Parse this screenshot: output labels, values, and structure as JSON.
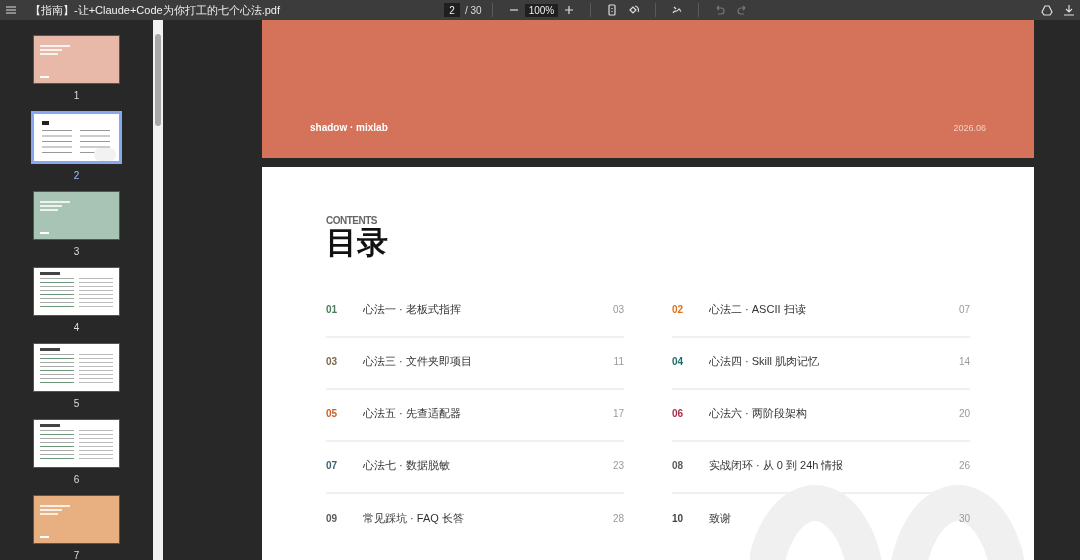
{
  "toolbar": {
    "title": "【指南】-让+Claude+Code为你打工的七个心法.pdf",
    "page_input": "2",
    "page_total": "/ 30",
    "zoom": "100%"
  },
  "thumbnails": [
    {
      "kind": "cover",
      "color": "#e8b8a8",
      "label": "1",
      "selected": false
    },
    {
      "kind": "contents",
      "label": "2",
      "selected": true
    },
    {
      "kind": "cover",
      "color": "#a8c4b4",
      "label": "3",
      "selected": false
    },
    {
      "kind": "text",
      "label": "4",
      "selected": false
    },
    {
      "kind": "text",
      "label": "5",
      "selected": false
    },
    {
      "kind": "text",
      "label": "6",
      "selected": false
    },
    {
      "kind": "cover",
      "color": "#e8b080",
      "label": "7",
      "selected": false
    }
  ],
  "previous_page": {
    "brand": "shadow · mixlab",
    "date": "2026.06"
  },
  "contents_page": {
    "eyebrow": "CONTENTS",
    "heading": "目录",
    "entries": [
      {
        "number": "01",
        "color": "#4a7a5c",
        "title": "心法一 · 老板式指挥",
        "page": "03"
      },
      {
        "number": "02",
        "color": "#e07020",
        "title": "心法二 · ASCII 扫读",
        "page": "07"
      },
      {
        "number": "03",
        "color": "#7a6a4a",
        "title": "心法三 · 文件夹即项目",
        "page": "11"
      },
      {
        "number": "04",
        "color": "#1a6a6a",
        "title": "心法四 · Skill 肌肉记忆",
        "page": "14"
      },
      {
        "number": "05",
        "color": "#c8602a",
        "title": "心法五 · 先查适配器",
        "page": "17"
      },
      {
        "number": "06",
        "color": "#a83048",
        "title": "心法六 · 两阶段架构",
        "page": "20"
      },
      {
        "number": "07",
        "color": "#3a6070",
        "title": "心法七 · 数据脱敏",
        "page": "23"
      },
      {
        "number": "08",
        "color": "#5a5a5a",
        "title": "实战闭环 · 从 0 到 24h 情报",
        "page": "26"
      },
      {
        "number": "09",
        "color": "#5a5a5a",
        "title": "常见踩坑 · FAQ 长答",
        "page": "28"
      },
      {
        "number": "10",
        "color": "#444444",
        "title": "致谢",
        "page": "30"
      }
    ]
  }
}
